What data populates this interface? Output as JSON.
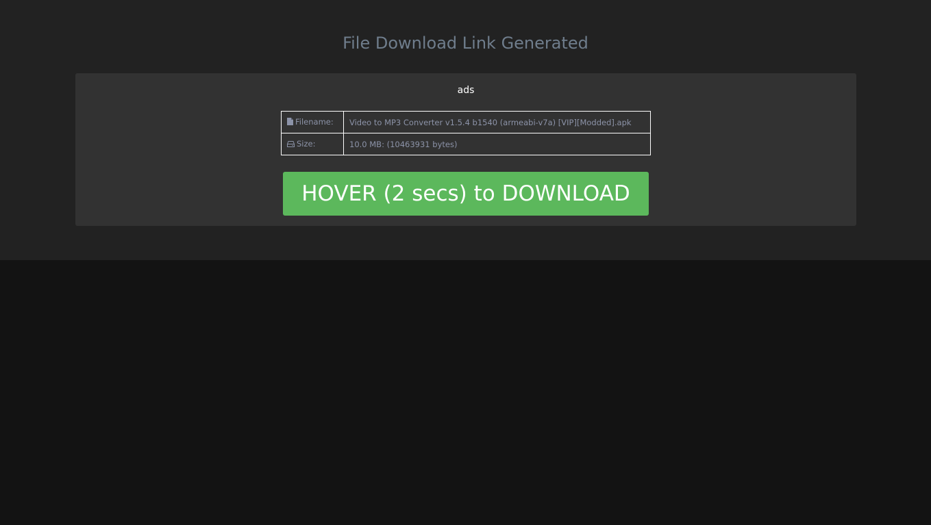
{
  "page": {
    "title": "File Download Link Generated"
  },
  "card": {
    "ads_label": "ads",
    "file_info": {
      "filename_label": "Filename:",
      "filename_value": "Video to MP3 Converter v1.5.4 b1540 (armeabi-v7a) [VIP][Modded].apk",
      "size_label": "Size:",
      "size_value": "10.0 MB: (10463931 bytes)"
    },
    "download_button_label": "HOVER (2 secs) to DOWNLOAD"
  },
  "icons": {
    "filename": "file-icon",
    "size": "hard-drive-icon"
  },
  "colors": {
    "page_background": "#131313",
    "header_background": "#222222",
    "card_background": "#323232",
    "title_text": "#6f7d8c",
    "table_text": "#8c93a8",
    "button_background": "#5cb85c",
    "button_text": "#ffffff"
  }
}
